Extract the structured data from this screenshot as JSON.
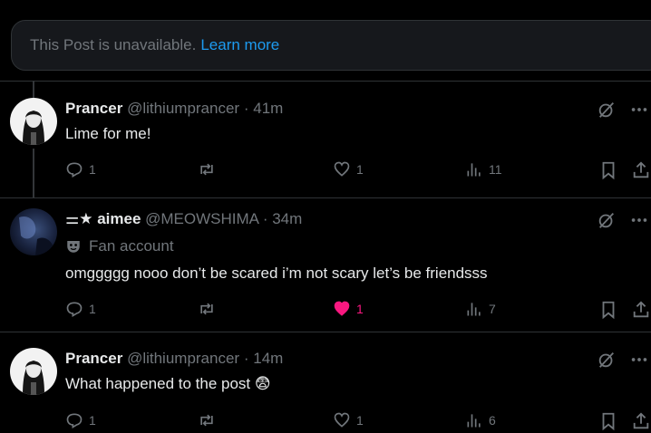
{
  "notice": {
    "text": "This Post is unavailable.",
    "link": "Learn more"
  },
  "posts": [
    {
      "name": "Prancer",
      "handle": "@lithiumprancer",
      "sep": "·",
      "time": "41m",
      "text": "Lime for me!",
      "replies": "1",
      "reposts": "",
      "likes": "1",
      "views": "11",
      "liked": false
    },
    {
      "name": "⚌★ aimee",
      "handle": "@MEOWSHIMA",
      "sep": "·",
      "time": "34m",
      "badge": "Fan account",
      "text": "omggggg nooo don’t be scared i’m not scary let’s be friendsss",
      "replies": "1",
      "reposts": "",
      "likes": "1",
      "views": "7",
      "liked": true
    },
    {
      "name": "Prancer",
      "handle": "@lithiumprancer",
      "sep": "·",
      "time": "14m",
      "text": "What happened to the post",
      "emoji": "😨",
      "replies": "1",
      "reposts": "",
      "likes": "1",
      "views": "6",
      "liked": false
    }
  ],
  "colors": {
    "accent": "#1d9bf0",
    "like": "#f91880",
    "muted": "#71767b",
    "background": "#000000"
  }
}
